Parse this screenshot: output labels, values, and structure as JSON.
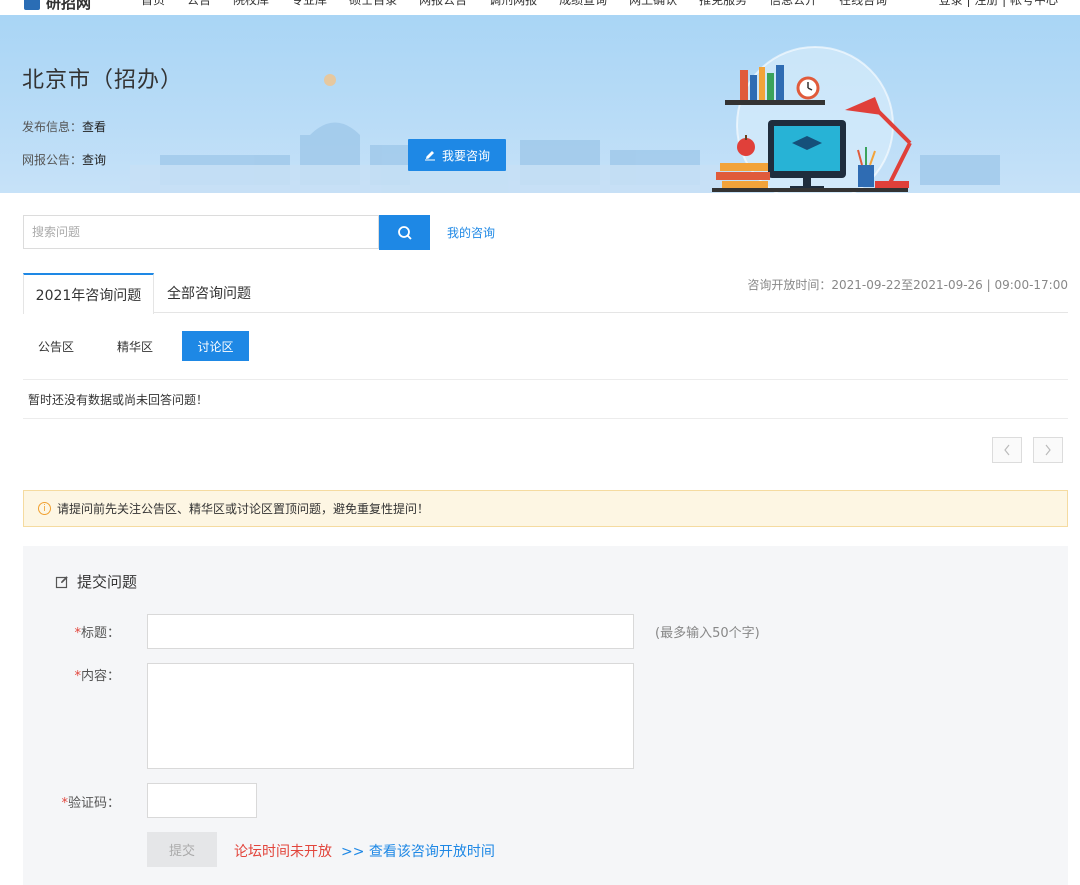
{
  "topnav": {
    "logo": "研招网",
    "items": [
      "首页",
      "公告",
      "院校库",
      "专业库",
      "硕士目录",
      "网报公告",
      "调剂网报",
      "成绩查询",
      "网上确认",
      "推免服务",
      "信息公开",
      "在线咨询"
    ],
    "right": "登录 | 注册 | 帐号中心"
  },
  "banner": {
    "title": "北京市（招办）",
    "info": [
      {
        "label": "发布信息：",
        "link": "查看"
      },
      {
        "label": "网报公告：",
        "link": "查询"
      }
    ],
    "consult_button": "我要咨询"
  },
  "search": {
    "placeholder": "搜索问题",
    "my_consult": "我的咨询"
  },
  "tabs": [
    "2021年咨询问题",
    "全部咨询问题"
  ],
  "open_time": "咨询开放时间：2021-09-22至2021-09-26 | 09:00-17:00",
  "subtabs": [
    "公告区",
    "精华区",
    "讨论区"
  ],
  "active_subtab": "讨论区",
  "empty_message": "暂时还没有数据或尚未回答问题！",
  "notice": "请提问前先关注公告区、精华区或讨论区置顶问题，避免重复性提问！",
  "form": {
    "title": "提交问题",
    "required_mark": "*",
    "title_label": "标题：",
    "title_hint": "(最多输入50个字)",
    "content_label": "内容：",
    "captcha_label": "验证码：",
    "submit": "提交",
    "closed_message": "论坛时间未开放",
    "arrow": ">>",
    "view_time_link": "查看该咨询开放时间"
  },
  "colors": {
    "accent": "#1e88e5",
    "banner_bg": "#b3d9f6",
    "warning_bg": "#fdf6e3",
    "error_text": "#e2453c"
  },
  "icons": {
    "search": "search-icon",
    "edit": "pencil-icon",
    "form": "edit-square-icon",
    "warning": "info-circle-icon",
    "prev": "chevron-left-icon",
    "next": "chevron-right-icon"
  }
}
